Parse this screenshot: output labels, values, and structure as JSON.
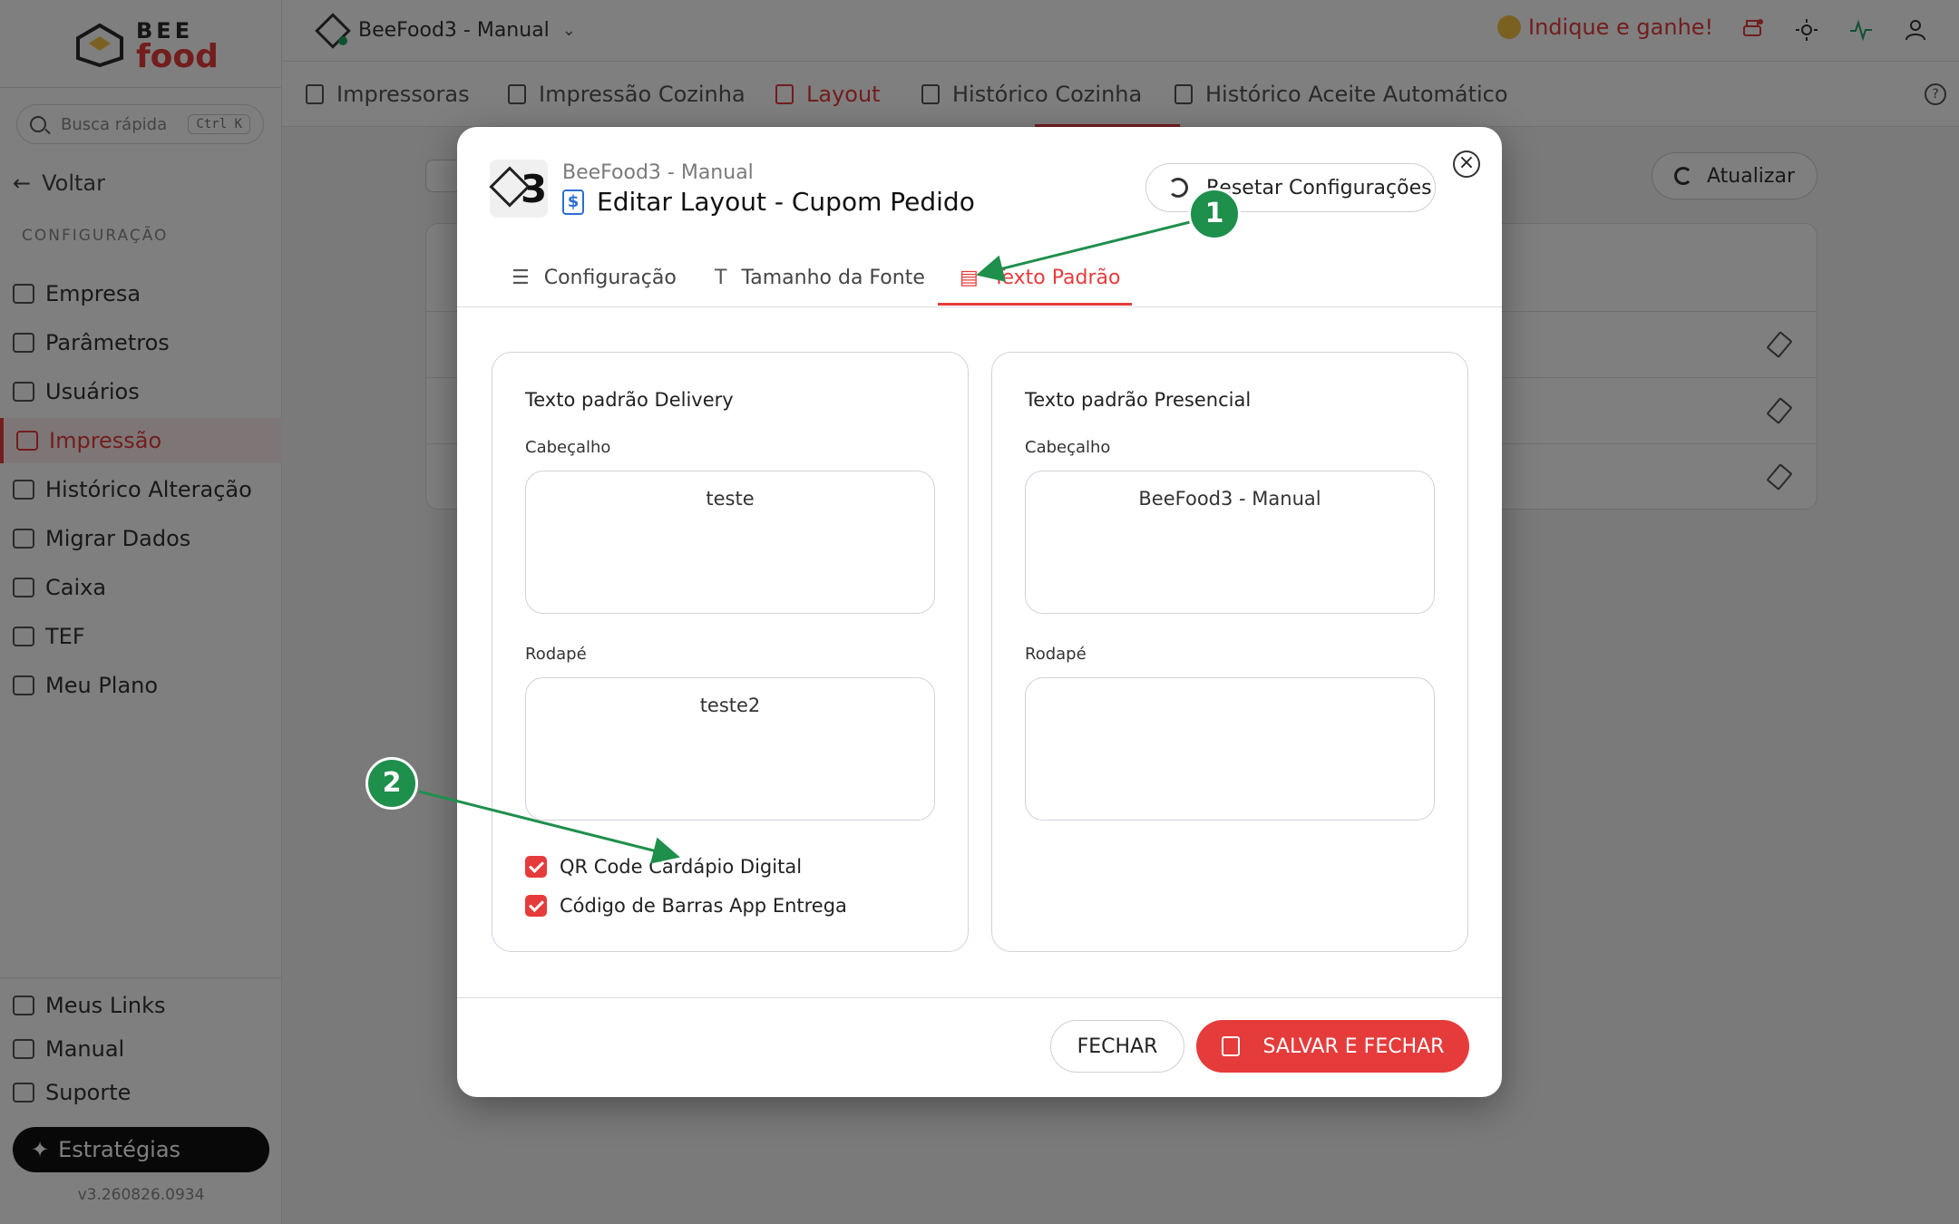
{
  "sidebar": {
    "logo_top": "BEE",
    "logo_bottom": "food",
    "search_placeholder": "Busca rápida",
    "search_shortcut": "Ctrl K",
    "back_label": "Voltar",
    "section_label": "CONFIGURAÇÃO",
    "items": [
      {
        "label": "Empresa",
        "icon": "building-icon"
      },
      {
        "label": "Parâmetros",
        "icon": "gear-icon"
      },
      {
        "label": "Usuários",
        "icon": "users-icon"
      },
      {
        "label": "Impressão",
        "icon": "printer-icon",
        "active": true
      },
      {
        "label": "Histórico Alteração",
        "icon": "history-icon"
      },
      {
        "label": "Migrar Dados",
        "icon": "database-icon"
      },
      {
        "label": "Caixa",
        "icon": "wallet-icon"
      },
      {
        "label": "TEF",
        "icon": "card-icon"
      },
      {
        "label": "Meu Plano",
        "icon": "crown-icon"
      }
    ],
    "bottom_items": [
      {
        "label": "Meus Links",
        "icon": "link-icon"
      },
      {
        "label": "Manual",
        "icon": "book-icon"
      },
      {
        "label": "Suporte",
        "icon": "headset-icon"
      }
    ],
    "strategies_label": "Estratégias",
    "version": "v3.260826.0934"
  },
  "topbar": {
    "store_name": "BeeFood3 - Manual",
    "refer_label": "Indique e ganhe!"
  },
  "tabs": [
    {
      "label": "Impressoras"
    },
    {
      "label": "Impressão Cozinha"
    },
    {
      "label": "Layout",
      "active": true
    },
    {
      "label": "Histórico Cozinha"
    },
    {
      "label": "Histórico Aceite Automático"
    }
  ],
  "page": {
    "refresh_label": "Atualizar"
  },
  "modal": {
    "subtitle": "BeeFood3 - Manual",
    "title": "Editar Layout - Cupom Pedido",
    "reset_label": "Resetar Configurações",
    "close_glyph": "×",
    "tabs": [
      {
        "label": "Configuração",
        "icon": "sliders-icon"
      },
      {
        "label": "Tamanho da Fonte",
        "icon": "text-size-icon"
      },
      {
        "label": "Texto Padrão",
        "icon": "document-icon",
        "active": true
      }
    ],
    "delivery": {
      "title": "Texto padrão Delivery",
      "header_label": "Cabeçalho",
      "header_value": "teste",
      "footer_label": "Rodapé",
      "footer_value": "teste2",
      "checkboxes": [
        {
          "label": "QR Code Cardápio Digital",
          "checked": true
        },
        {
          "label": "Código de Barras App Entrega",
          "checked": true
        }
      ]
    },
    "presencial": {
      "title": "Texto padrão Presencial",
      "header_label": "Cabeçalho",
      "header_value": "BeeFood3 - Manual",
      "footer_label": "Rodapé",
      "footer_value": ""
    },
    "close_button": "FECHAR",
    "save_button": "SALVAR E FECHAR"
  },
  "annotations": [
    {
      "number": "1",
      "target": "Texto Padrão tab"
    },
    {
      "number": "2",
      "target": "QR Code Cardápio Digital checkbox"
    }
  ],
  "colors": {
    "accent": "#e63b3b",
    "marker": "#1f8f4c",
    "title_icon": "#2a6dd9"
  }
}
